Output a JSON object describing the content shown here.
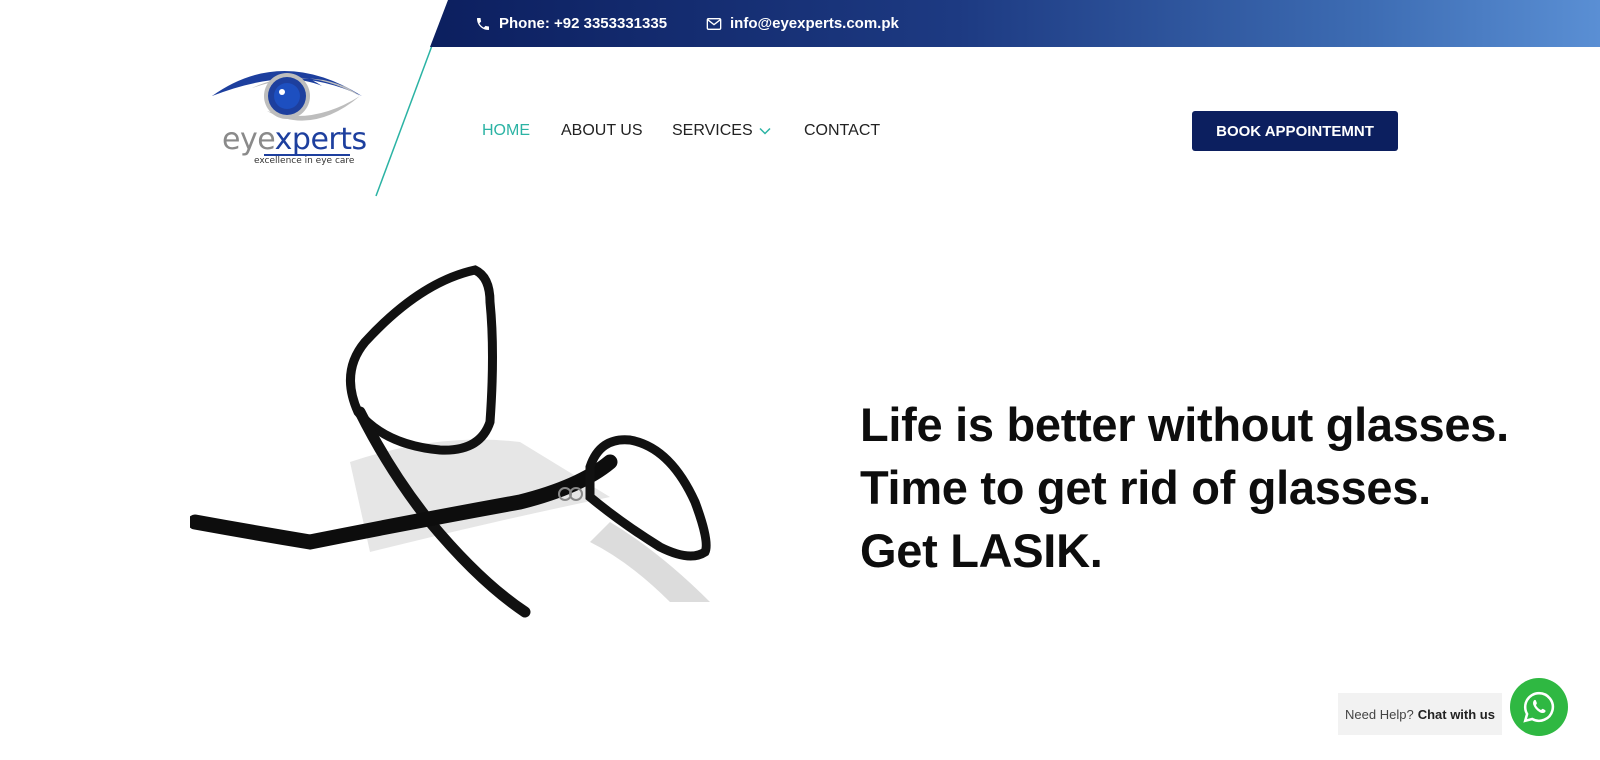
{
  "topbar": {
    "phone_text": "Phone: +92 3353331335",
    "email_text": "info@eyexperts.com.pk",
    "phone_icon": "phone-icon",
    "email_icon": "envelope-icon"
  },
  "logo": {
    "word_gray": "eye",
    "word_blue": "xperts",
    "tagline": "excellence in eye care"
  },
  "nav": {
    "items": [
      {
        "label": "HOME",
        "active": true
      },
      {
        "label": "ABOUT US",
        "active": false
      },
      {
        "label": "SERVICES",
        "active": false,
        "has_dropdown": true
      },
      {
        "label": "CONTACT",
        "active": false
      }
    ],
    "cta_label": "BOOK APPOINTEMNT"
  },
  "hero": {
    "lines": [
      "Life is better without glasses.",
      "Time to get rid of glasses.",
      "Get LASIK."
    ],
    "image": "black-eyeglasses-photo"
  },
  "help": {
    "prefix": "Need Help?",
    "action": "Chat with us",
    "icon": "whatsapp-icon"
  },
  "colors": {
    "navy": "#0c1f5f",
    "teal_active": "#2bb3a4",
    "whatsapp_green": "#2fb842",
    "logo_blue": "#1d3f9e"
  }
}
